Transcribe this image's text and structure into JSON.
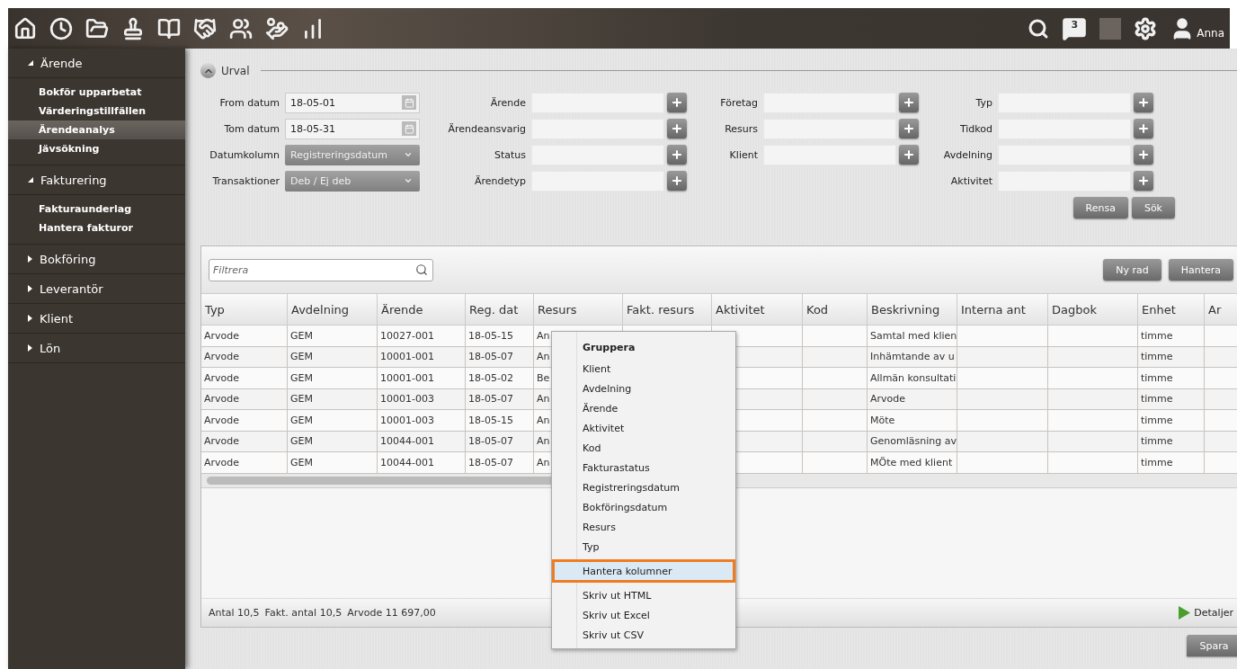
{
  "topbar": {
    "notification_count": "3",
    "user_name": "Anna"
  },
  "sidebar": {
    "sections": [
      {
        "label": "Ärende",
        "expanded": true,
        "items": [
          {
            "label": "Bokför upparbetat",
            "selected": false
          },
          {
            "label": "Värderingstillfällen",
            "selected": false
          },
          {
            "label": "Ärendeanalys",
            "selected": true
          },
          {
            "label": "Jävsökning",
            "selected": false
          }
        ]
      },
      {
        "label": "Fakturering",
        "expanded": true,
        "items": [
          {
            "label": "Fakturaunderlag",
            "selected": false
          },
          {
            "label": "Hantera fakturor",
            "selected": false
          }
        ]
      },
      {
        "label": "Bokföring",
        "expanded": false
      },
      {
        "label": "Leverantör",
        "expanded": false
      },
      {
        "label": "Klient",
        "expanded": false
      },
      {
        "label": "Lön",
        "expanded": false
      }
    ]
  },
  "urval": {
    "title": "Urval",
    "expanded": true,
    "columns": [
      [
        {
          "label": "From datum",
          "kind": "date",
          "value": "18-05-01"
        },
        {
          "label": "Tom datum",
          "kind": "date",
          "value": "18-05-31"
        },
        {
          "label": "Datumkolumn",
          "kind": "select",
          "value": "Registreringsdatum"
        },
        {
          "label": "Transaktioner",
          "kind": "select",
          "value": "Deb / Ej deb"
        }
      ],
      [
        {
          "label": "Ärende",
          "kind": "lookup"
        },
        {
          "label": "Ärendeansvarig",
          "kind": "lookup"
        },
        {
          "label": "Status",
          "kind": "lookup"
        },
        {
          "label": "Ärendetyp",
          "kind": "lookup"
        }
      ],
      [
        {
          "label": "Företag",
          "kind": "lookup"
        },
        {
          "label": "Resurs",
          "kind": "lookup"
        },
        {
          "label": "Klient",
          "kind": "lookup"
        }
      ],
      [
        {
          "label": "Typ",
          "kind": "lookup"
        },
        {
          "label": "Tidkod",
          "kind": "lookup"
        },
        {
          "label": "Avdelning",
          "kind": "lookup"
        },
        {
          "label": "Aktivitet",
          "kind": "lookup"
        }
      ]
    ],
    "buttons": [
      "Rensa",
      "Sök"
    ]
  },
  "grid": {
    "filter": {
      "placeholder": "Filtrera"
    },
    "buttons": [
      "Ny rad",
      "Hantera"
    ],
    "columns": [
      "Typ",
      "Avdelning",
      "Ärende",
      "Reg. dat",
      "Resurs",
      "Fakt. resurs",
      "Aktivitet",
      "Kod",
      "Beskrivning",
      "Interna ant",
      "Dagbok",
      "Enhet",
      "Ar"
    ],
    "rows": [
      [
        "Arvode",
        "GEM",
        "10027-001",
        "18-05-15",
        "An",
        null,
        null,
        null,
        "Samtal med klien",
        null,
        null,
        "timme",
        null
      ],
      [
        "Arvode",
        "GEM",
        "10001-001",
        "18-05-07",
        "An",
        null,
        null,
        null,
        "Inhämtande av u",
        null,
        null,
        "timme",
        null
      ],
      [
        "Arvode",
        "GEM",
        "10001-001",
        "18-05-02",
        "Be",
        null,
        null,
        null,
        "Allmän konsultati",
        null,
        null,
        "timme",
        null
      ],
      [
        "Arvode",
        "GEM",
        "10001-003",
        "18-05-07",
        "An",
        null,
        null,
        null,
        "Arvode",
        null,
        null,
        "timme",
        null
      ],
      [
        "Arvode",
        "GEM",
        "10001-003",
        "18-05-15",
        "An",
        null,
        null,
        null,
        "Möte",
        null,
        null,
        "timme",
        null
      ],
      [
        "Arvode",
        "GEM",
        "10044-001",
        "18-05-07",
        "An",
        null,
        null,
        null,
        "Genomläsning av",
        null,
        null,
        "timme",
        null
      ],
      [
        "Arvode",
        "GEM",
        "10044-001",
        "18-05-07",
        "An",
        null,
        null,
        null,
        "MÖte med klient",
        null,
        null,
        "timme",
        null
      ]
    ],
    "summary": [
      "Antal 10,5",
      "Fakt. antal 10,5",
      "Arvode 11 697,00"
    ],
    "details_link": "Detaljer"
  },
  "context_menu": {
    "title": "Gruppera",
    "groups": [
      [
        {
          "label": "Klient",
          "selected": false
        },
        {
          "label": "Avdelning",
          "selected": false
        },
        {
          "label": "Ärende",
          "selected": false
        },
        {
          "label": "Aktivitet",
          "selected": false
        },
        {
          "label": "Kod",
          "selected": false
        },
        {
          "label": "Fakturastatus",
          "selected": false
        },
        {
          "label": "Registreringsdatum",
          "selected": false
        },
        {
          "label": "Bokföringsdatum",
          "selected": false
        },
        {
          "label": "Resurs",
          "selected": false
        },
        {
          "label": "Typ",
          "selected": false
        }
      ],
      [
        {
          "label": "Hantera kolumner",
          "selected": true
        }
      ],
      [
        {
          "label": "Skriv ut HTML",
          "selected": false
        },
        {
          "label": "Skriv ut Excel",
          "selected": false
        },
        {
          "label": "Skriv ut CSV",
          "selected": false
        }
      ]
    ]
  },
  "save_button": "Spara"
}
